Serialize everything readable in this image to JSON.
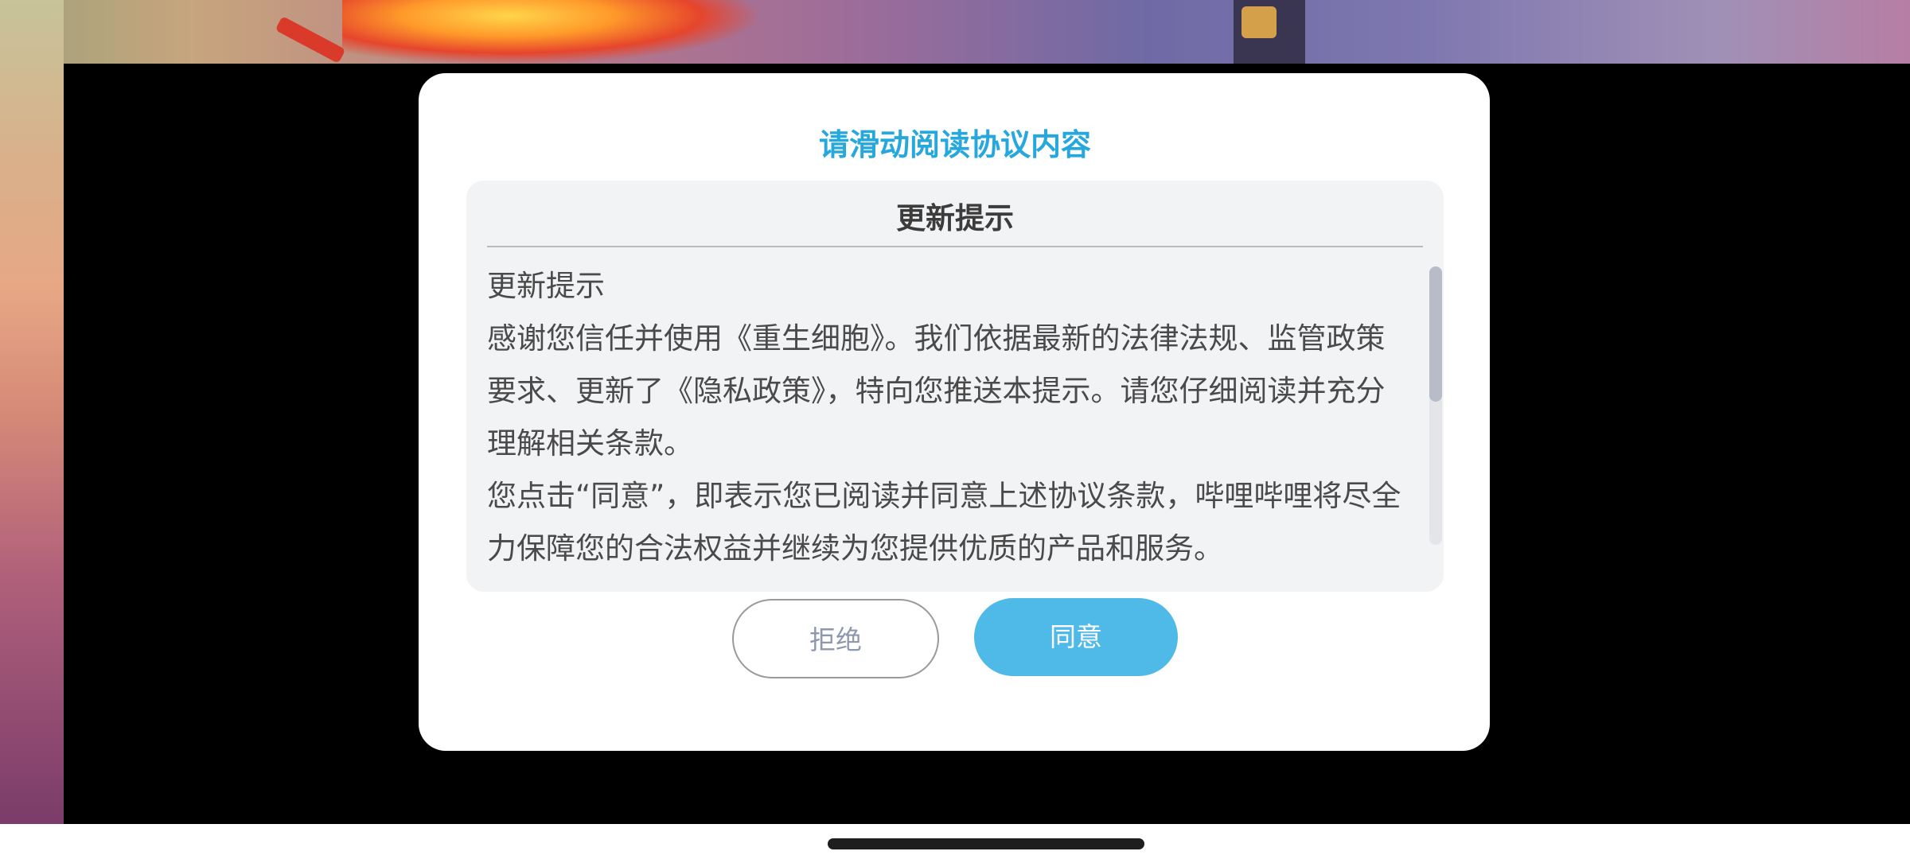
{
  "dialog": {
    "title": "请滑动阅读协议内容",
    "panel_title": "更新提示",
    "paragraphs": [
      "更新提示",
      "感谢您信任并使用《重生细胞》。我们依据最新的法律法规、监管政策要求、更新了《隐私政策》，特向您推送本提示。请您仔细阅读并充分理解相关条款。",
      "您点击“同意”，即表示您已阅读并同意上述协议条款，哔哩哔哩将尽全力保障您的合法权益并继续为您提供优质的产品和服务。"
    ],
    "reject_label": "拒绝",
    "agree_label": "同意"
  },
  "colors": {
    "title": "#27a8dc",
    "agree_button": "#4fb9e8",
    "reject_text": "#8d98ad",
    "panel_bg": "#f2f3f5"
  }
}
